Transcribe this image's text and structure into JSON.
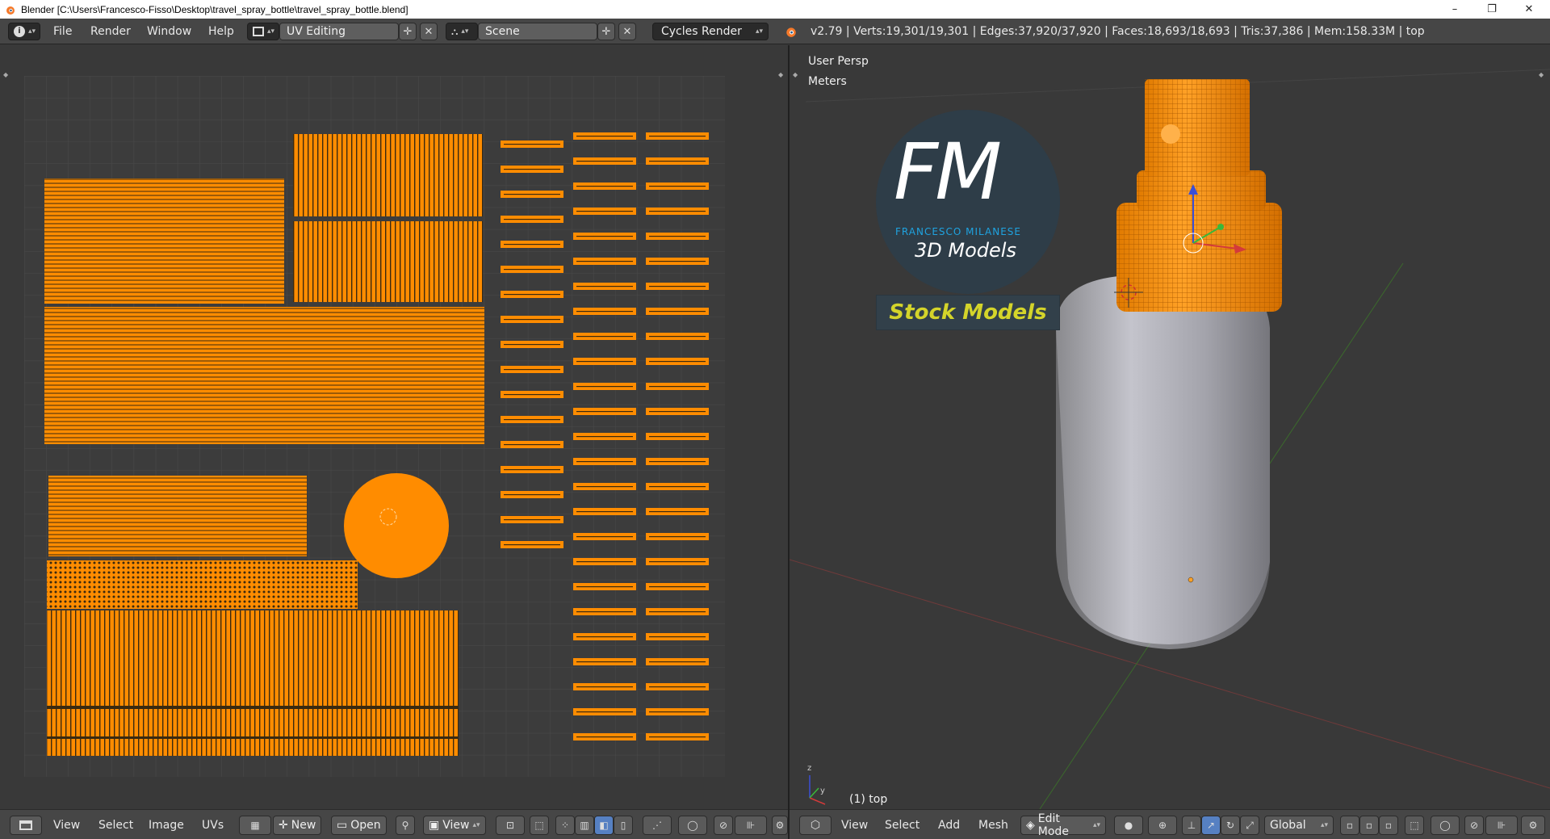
{
  "window": {
    "title": "Blender [C:\\Users\\Francesco-Fisso\\Desktop\\travel_spray_bottle\\travel_spray_bottle.blend]",
    "minimize": "–",
    "restore": "❐",
    "close": "✕"
  },
  "info_header": {
    "menus": [
      "File",
      "Render",
      "Window",
      "Help"
    ],
    "screen_layout": "UV Editing",
    "scene": "Scene",
    "render_engine": "Cycles Render",
    "stats": "v2.79 | Verts:19,301/19,301 | Edges:37,920/37,920 | Faces:18,693/18,693 | Tris:37,386 | Mem:158.33M | top"
  },
  "uv_editor": {
    "header_menus": [
      "View",
      "Select",
      "Image",
      "UVs"
    ],
    "new_label": "New",
    "open_label": "Open",
    "view_label": "View"
  },
  "viewport": {
    "view_name": "User Persp",
    "units": "Meters",
    "object_label": "(1) top",
    "header_menus": [
      "View",
      "Select",
      "Add",
      "Mesh"
    ],
    "mode": "Edit Mode",
    "orientation": "Global"
  },
  "logo": {
    "letters": "FM",
    "name": "FRANCESCO MILANESE",
    "tagline": "3D Models",
    "banner": "Stock Models"
  },
  "colors": {
    "uv_orange": "#ff8c00",
    "bg_panel": "#464646",
    "active_blue": "#5680c2",
    "banner_yellow": "#d4d42a",
    "logo_blue": "#1fa3e0"
  }
}
